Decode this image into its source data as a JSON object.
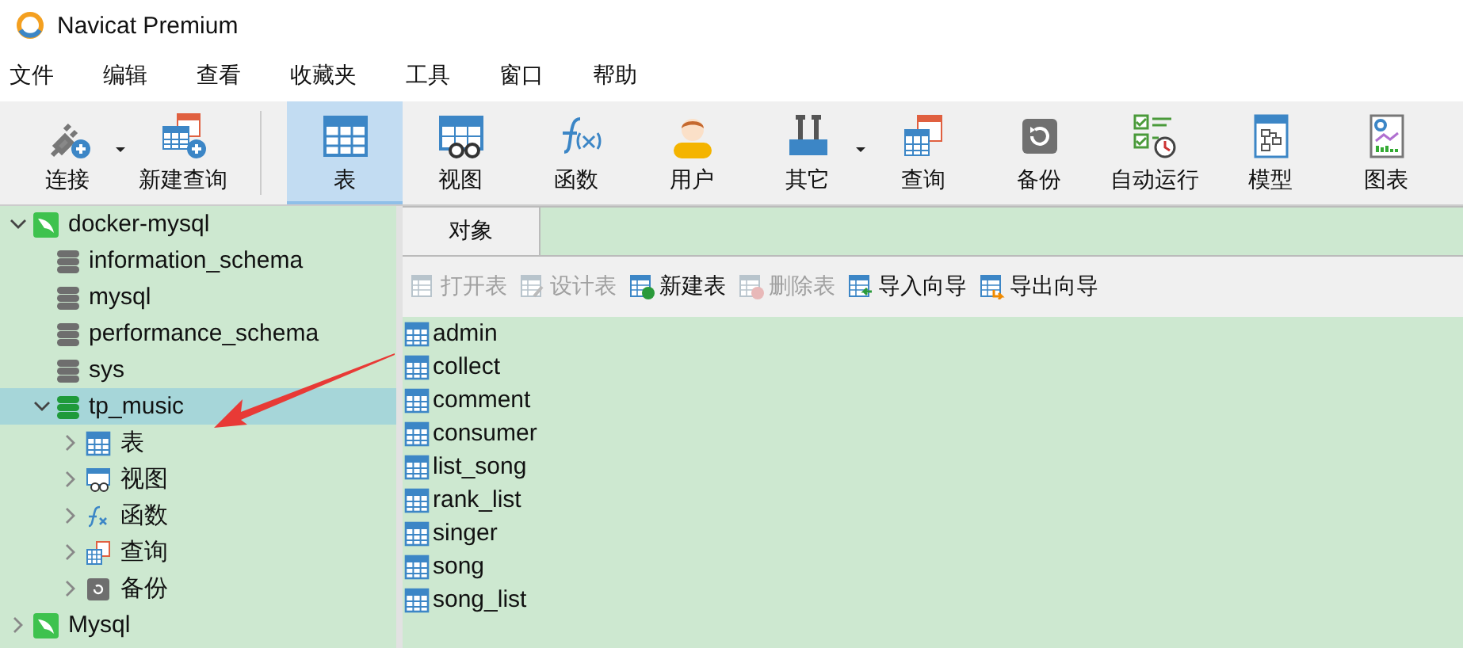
{
  "window": {
    "title": "Navicat Premium"
  },
  "menu": [
    "文件",
    "编辑",
    "查看",
    "收藏夹",
    "工具",
    "窗口",
    "帮助"
  ],
  "toolbar": [
    {
      "label": "连接",
      "kind": "plug",
      "selected": false,
      "dropdown": true
    },
    {
      "label": "新建查询",
      "kind": "newquery",
      "selected": false
    },
    {
      "label": "表",
      "kind": "table",
      "selected": true,
      "separator_before": true
    },
    {
      "label": "视图",
      "kind": "view",
      "selected": false
    },
    {
      "label": "函数",
      "kind": "function",
      "selected": false
    },
    {
      "label": "用户",
      "kind": "user",
      "selected": false
    },
    {
      "label": "其它",
      "kind": "tools",
      "selected": false,
      "dropdown": true
    },
    {
      "label": "查询",
      "kind": "query",
      "selected": false
    },
    {
      "label": "备份",
      "kind": "backup",
      "selected": false
    },
    {
      "label": "自动运行",
      "kind": "schedule",
      "selected": false
    },
    {
      "label": "模型",
      "kind": "model",
      "selected": false
    },
    {
      "label": "图表",
      "kind": "chart",
      "selected": false
    }
  ],
  "tree": [
    {
      "label": "docker-mysql",
      "kind": "connection",
      "expanded": true,
      "selected": false,
      "children": [
        {
          "label": "information_schema",
          "kind": "database",
          "open": false,
          "selected": false
        },
        {
          "label": "mysql",
          "kind": "database",
          "open": false,
          "selected": false
        },
        {
          "label": "performance_schema",
          "kind": "database",
          "open": false,
          "selected": false
        },
        {
          "label": "sys",
          "kind": "database",
          "open": false,
          "selected": false
        },
        {
          "label": "tp_music",
          "kind": "database",
          "open": true,
          "expanded": true,
          "selected": true,
          "children": [
            {
              "label": "表",
              "kind": "table",
              "expanded": false,
              "selected": false
            },
            {
              "label": "视图",
              "kind": "view",
              "expanded": false,
              "selected": false
            },
            {
              "label": "函数",
              "kind": "function",
              "expanded": false,
              "selected": false
            },
            {
              "label": "查询",
              "kind": "query",
              "expanded": false,
              "selected": false
            },
            {
              "label": "备份",
              "kind": "backup",
              "expanded": false,
              "selected": false
            }
          ]
        }
      ]
    },
    {
      "label": "Mysql",
      "kind": "connection",
      "expanded": false,
      "selected": false
    }
  ],
  "tabs": [
    {
      "label": "对象",
      "selected": true
    }
  ],
  "object_toolbar": [
    {
      "label": "打开表",
      "kind": "open",
      "disabled": true
    },
    {
      "label": "设计表",
      "kind": "design",
      "disabled": true
    },
    {
      "label": "新建表",
      "kind": "new",
      "disabled": false
    },
    {
      "label": "删除表",
      "kind": "delete",
      "disabled": true
    },
    {
      "label": "导入向导",
      "kind": "import",
      "disabled": false
    },
    {
      "label": "导出向导",
      "kind": "export",
      "disabled": false
    }
  ],
  "tables": [
    "admin",
    "collect",
    "comment",
    "consumer",
    "list_song",
    "rank_list",
    "singer",
    "song",
    "song_list"
  ]
}
